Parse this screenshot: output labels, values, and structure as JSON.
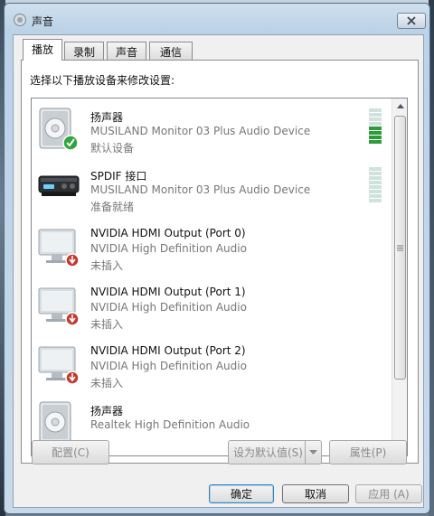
{
  "window": {
    "title": "声音",
    "close_icon": "close-icon",
    "title_icon": "speaker-icon"
  },
  "tabs": [
    {
      "label": "播放",
      "active": true
    },
    {
      "label": "录制",
      "active": false
    },
    {
      "label": "声音",
      "active": false
    },
    {
      "label": "通信",
      "active": false
    }
  ],
  "prompt": "选择以下播放设备来修改设置:",
  "devices": [
    {
      "name": "扬声器",
      "desc": "MUSILAND Monitor 03 Plus Audio Device",
      "status": "默认设备",
      "icon": "speaker-default-icon",
      "level": 0.5
    },
    {
      "name": "SPDIF 接口",
      "desc": "MUSILAND Monitor 03 Plus Audio Device",
      "status": "准备就绪",
      "icon": "spdif-device-icon",
      "level": 0
    },
    {
      "name": "NVIDIA HDMI Output (Port 0)",
      "desc": "NVIDIA High Definition Audio",
      "status": "未插入",
      "icon": "monitor-unplugged-icon"
    },
    {
      "name": "NVIDIA HDMI Output (Port 1)",
      "desc": "NVIDIA High Definition Audio",
      "status": "未插入",
      "icon": "monitor-unplugged-icon"
    },
    {
      "name": "NVIDIA HDMI Output (Port 2)",
      "desc": "NVIDIA High Definition Audio",
      "status": "未插入",
      "icon": "monitor-unplugged-icon"
    },
    {
      "name": "扬声器",
      "desc": "Realtek High Definition Audio",
      "status": "",
      "icon": "speaker-icon"
    }
  ],
  "buttons": {
    "configure": "配置(C)",
    "set_default": "设为默认值(S)",
    "properties": "属性(P)",
    "ok": "确定",
    "cancel": "取消",
    "apply": "应用 (A)"
  },
  "colors": {
    "meter_on": "#2f9a3c",
    "meter_off": "#cfe3dc",
    "accent": "#3c7fb1"
  }
}
